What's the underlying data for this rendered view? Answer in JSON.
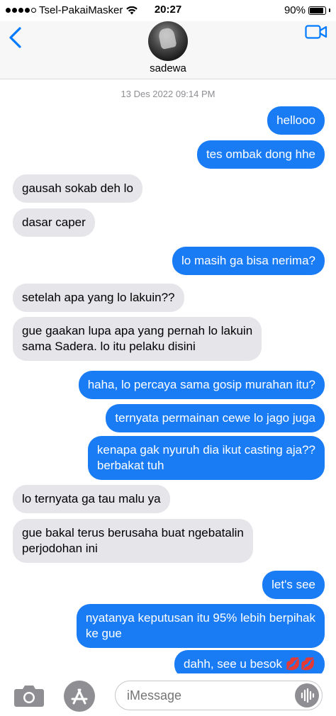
{
  "status_bar": {
    "carrier": "Tsel-PakaiMasker",
    "time": "20:27",
    "battery_text": "90%",
    "battery_level": 0.9,
    "signal_bars_filled": 4,
    "signal_bars_total": 5
  },
  "header": {
    "contact_name": "sadewa",
    "back_icon": "chevron-left-icon",
    "video_icon": "video-camera-icon"
  },
  "conversation": {
    "timestamp": "13 Des 2022 09:14 PM",
    "messages": [
      {
        "dir": "out",
        "text": "hellooo"
      },
      {
        "dir": "out",
        "text": "tes ombak dong hhe"
      },
      {
        "dir": "in",
        "text": "gausah sokab deh lo"
      },
      {
        "dir": "in",
        "text": "dasar caper"
      },
      {
        "dir": "out",
        "text": "lo masih ga bisa nerima?"
      },
      {
        "dir": "in",
        "text": "setelah apa yang lo lakuin??"
      },
      {
        "dir": "in",
        "text": "gue gaakan lupa apa yang pernah lo lakuin\nsama Sadera. lo itu pelaku disini"
      },
      {
        "dir": "out",
        "text": "haha, lo percaya sama gosip murahan itu?"
      },
      {
        "dir": "out",
        "text": "ternyata permainan cewe lo jago juga"
      },
      {
        "dir": "out",
        "text": "kenapa gak nyuruh dia ikut casting aja??\nberbakat tuh"
      },
      {
        "dir": "in",
        "text": "lo ternyata ga tau malu ya"
      },
      {
        "dir": "in",
        "text": "gue bakal terus berusaha buat ngebatalin\nperjodohan ini"
      },
      {
        "dir": "out",
        "text": "let's see"
      },
      {
        "dir": "out",
        "text": "nyatanya keputusan itu 95% lebih berpihak\nke gue"
      },
      {
        "dir": "out",
        "text": "dahh, see u besok 💋💋"
      }
    ]
  },
  "composer": {
    "placeholder": "iMessage",
    "camera_icon": "camera-icon",
    "apps_icon": "app-store-icon",
    "audio_icon": "audio-waveform-icon"
  },
  "colors": {
    "outgoing_bubble": "#1a7cf5",
    "incoming_bubble": "#e5e5ea",
    "accent": "#007aff",
    "muted": "#8e8e93"
  }
}
